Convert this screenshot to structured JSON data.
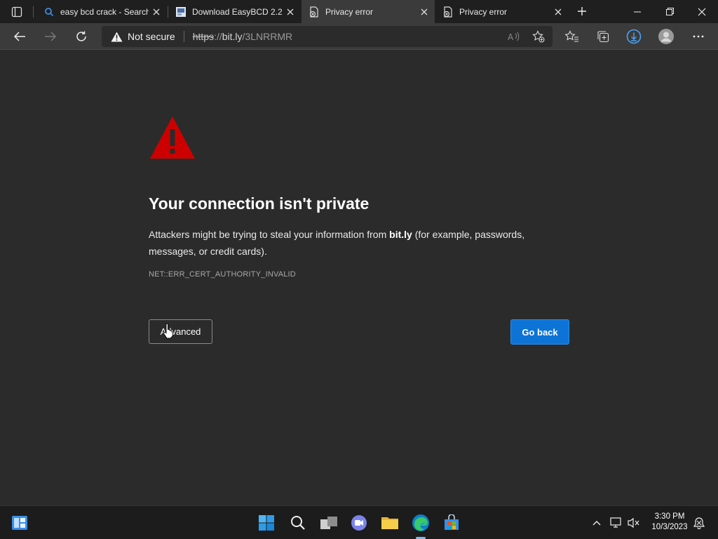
{
  "tabs": [
    {
      "label": "easy bcd crack - Search",
      "icon": "search-icon"
    },
    {
      "label": "Download EasyBCD 2.2",
      "icon": "site-favicon"
    },
    {
      "label": "Privacy error",
      "icon": "privacy-error-icon",
      "active": true
    },
    {
      "label": "Privacy error",
      "icon": "privacy-error-icon"
    }
  ],
  "address": {
    "security_label": "Not secure",
    "url_protocol": "https",
    "url_sep": "://",
    "url_host": "bit.ly",
    "url_path": "/3LNRRMR"
  },
  "page": {
    "heading": "Your connection isn't private",
    "desc_before": "Attackers might be trying to steal your information from ",
    "desc_host": "bit.ly",
    "desc_after": " (for example, passwords, messages, or credit cards).",
    "error_code": "NET::ERR_CERT_AUTHORITY_INVALID",
    "advanced_label": "Advanced",
    "go_back_label": "Go back"
  },
  "taskbar": {
    "time": "3:30 PM",
    "date": "10/3/2023"
  },
  "colors": {
    "accent": "#0e73d6",
    "warning_red": "#cc0000",
    "background": "#2b2b2b"
  }
}
